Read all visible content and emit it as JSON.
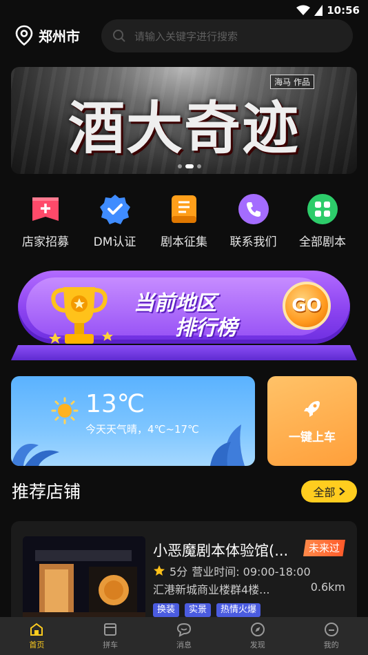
{
  "status_bar": {
    "time": "10:56"
  },
  "header": {
    "city": "郑州市",
    "search_placeholder": "请输入关键字进行搜索"
  },
  "banner": {
    "title": "酒大奇迹",
    "tag": "海马 作品",
    "dots": 3,
    "active_dot": 1
  },
  "quick_menu": [
    {
      "label": "店家招募",
      "icon": "store-recruit-icon",
      "color": "#ff4a6a"
    },
    {
      "label": "DM认证",
      "icon": "verified-badge-icon",
      "color": "#3f8cff"
    },
    {
      "label": "剧本征集",
      "icon": "script-book-icon",
      "color": "#ff9f1a"
    },
    {
      "label": "联系我们",
      "icon": "phone-icon",
      "color": "#a46cff"
    },
    {
      "label": "全部剧本",
      "icon": "grid-apps-icon",
      "color": "#2dcc6a"
    }
  ],
  "ranking": {
    "line1": "当前地区",
    "line2": "排行榜",
    "go_label": "GO"
  },
  "weather": {
    "temperature": "13℃",
    "description": "今天天气晴，4℃~17℃"
  },
  "quick_board": {
    "label": "一键上车"
  },
  "recommend": {
    "title": "推荐店铺",
    "all_label": "全部"
  },
  "stores": [
    {
      "name": "小恶魔剧本体验馆(...",
      "badge": "未来过",
      "rating": "5分",
      "hours": "营业时间: 09:00-18:00",
      "address": "汇港新城商业楼群4楼...",
      "distance": "0.6km",
      "tags": [
        "换装",
        "实景",
        "热情火爆"
      ]
    }
  ],
  "tabbar": [
    {
      "label": "首页",
      "icon": "home-icon",
      "active": true
    },
    {
      "label": "拼车",
      "icon": "carpool-icon",
      "active": false
    },
    {
      "label": "消息",
      "icon": "message-icon",
      "active": false
    },
    {
      "label": "发现",
      "icon": "discover-icon",
      "active": false
    },
    {
      "label": "我的",
      "icon": "profile-icon",
      "active": false
    }
  ],
  "colors": {
    "background": "#0d0d0d",
    "accent": "#ffcd1f",
    "ranking_purple": "#8b43f0",
    "tag_blue": "#4b5ce0"
  }
}
